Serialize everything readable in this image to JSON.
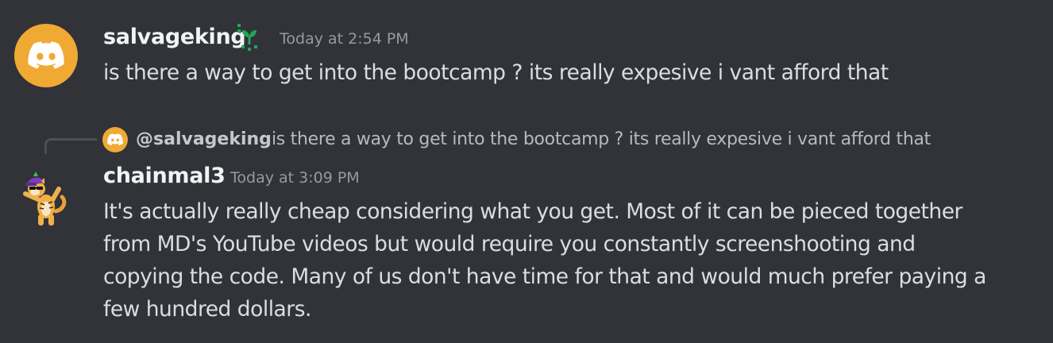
{
  "colors": {
    "background": "#313338",
    "avatar_bg": "#f0a932",
    "username": "#f2f3f5",
    "message_text": "#dbdee1",
    "timestamp": "#949ba4",
    "badge_green": "#23a55a"
  },
  "messages": [
    {
      "author": "salvageking",
      "avatar_icon": "discord-logo-icon",
      "badge_icon": "sprout-icon",
      "timestamp": "Today at 2:54 PM",
      "lines": [
        "is there a way to get into the bootcamp ? its really expesive i vant afford that"
      ]
    },
    {
      "reply": {
        "mention": "@salvageking",
        "avatar_icon": "discord-logo-icon",
        "preview": "is there a way to get into the bootcamp ? its really expesive i vant afford that"
      },
      "author": "chainmal3",
      "avatar_icon": "dabbing-tiger-avatar",
      "timestamp": "Today at 3:09 PM",
      "lines": [
        "It's actually really cheap considering what you get. Most of it can be pieced together",
        "from MD's YouTube videos but would require you constantly screenshooting and",
        "copying the code. Many of us don't have time for that and would much prefer paying a",
        "few hundred dollars."
      ]
    }
  ]
}
